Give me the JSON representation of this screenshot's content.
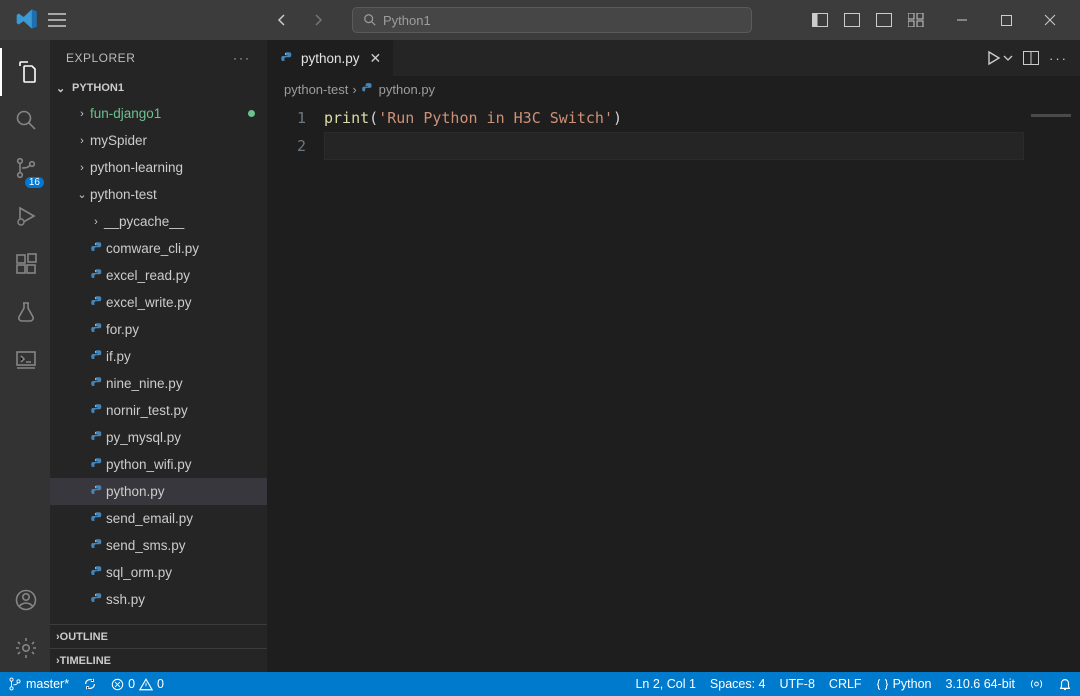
{
  "titlebar": {
    "search_prefix": " ",
    "search_text": "Python1"
  },
  "sidebar": {
    "title": "EXPLORER",
    "root": "PYTHON1",
    "folders": [
      {
        "name": "fun-django1",
        "modified": true
      },
      {
        "name": "mySpider"
      },
      {
        "name": "python-learning"
      },
      {
        "name": "python-test",
        "expanded": true
      }
    ],
    "pt_children_folder": "__pycache__",
    "files": [
      "comware_cli.py",
      "excel_read.py",
      "excel_write.py",
      "for.py",
      "if.py",
      "nine_nine.py",
      "nornir_test.py",
      "py_mysql.py",
      "python_wifi.py",
      "python.py",
      "send_email.py",
      "send_sms.py",
      "sql_orm.py",
      "ssh.py"
    ],
    "selected_file": "python.py",
    "sections": {
      "outline": "OUTLINE",
      "timeline": "TIMELINE"
    }
  },
  "activity_badge": "16",
  "tab": {
    "label": "python.py"
  },
  "breadcrumb": {
    "folder": "python-test",
    "file": "python.py"
  },
  "code": {
    "line1_fn": "print",
    "line1_open": "(",
    "line1_str": "'Run Python in H3C Switch'",
    "line1_close": ")",
    "line_numbers": [
      "1",
      "2"
    ]
  },
  "status": {
    "branch": "master*",
    "errors": "0",
    "warnings": "0",
    "cursor": "Ln 2, Col 1",
    "spaces": "Spaces: 4",
    "encoding": "UTF-8",
    "eol": "CRLF",
    "lang": "Python",
    "interpreter": "3.10.6 64-bit"
  }
}
